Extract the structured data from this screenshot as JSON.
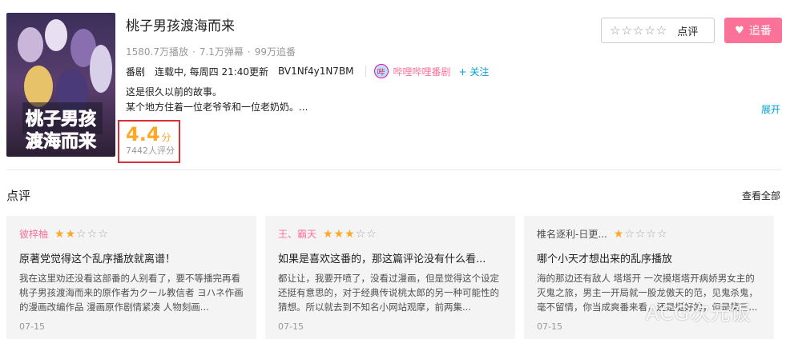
{
  "colors": {
    "accent": "#fb7299",
    "link": "#00a1d6",
    "score": "#ffa726",
    "highlight_border": "#d9313a"
  },
  "cover": {
    "title_overlay_top": "桃子男孩",
    "title_overlay_bottom": "渡海而来",
    "icon": "anime-cover-image"
  },
  "title": "桃子男孩渡海而来",
  "stats": {
    "plays": "1580.7万播放",
    "danmaku": "7.1万弹幕",
    "follows": "99万追番",
    "separator": "·"
  },
  "meta": {
    "type": "番剧",
    "status": "连载中, 每周四 21:40更新",
    "bvid": "BV1Nf4y1N7BM",
    "uploader": "哔哩哔哩番剧",
    "follow": "+ 关注"
  },
  "description": [
    "这是很久以前的故事。",
    "某个地方住着一位老爷爷和一位老奶奶。..."
  ],
  "expand": "展开",
  "score": {
    "value": "4.4",
    "unit": "分",
    "count": "7442人评分"
  },
  "rate_button": {
    "stars": "☆☆☆☆☆",
    "label": "点评"
  },
  "follow_button": {
    "label": "追番",
    "icon": "heart-icon"
  },
  "reviews_section": {
    "title": "点评",
    "see_all": "查看全部"
  },
  "reviews": [
    {
      "user": "彼梓柚",
      "rating": 2,
      "title": "原著党觉得这个乱序播放就离谱！",
      "body": "我在这里劝还没看这部番的人别看了，要不等播完再看桃子男孩渡海而来的原作者为クール教信者 ヨハネ作画的漫画改编作品 漫画原作剧情紧凑 人物刻画...",
      "date": "07-15"
    },
    {
      "user": "王、霸天",
      "rating": 3,
      "title": "如果是喜欢这番的，那这篇评论没有什么看...",
      "body": "都让让，我要开喷了，没看过漫画，但是觉得这个设定还挺有意思的，对于经典传说桃太郎的另一种可能性的猜想。所以就去到不知名小网站观摩，前两集...",
      "date": "07-15"
    },
    {
      "user": "椎名逐利-日更...",
      "rating": 1,
      "title": "哪个小天才想出来的乱序播放",
      "body": "海的那边还有敌人 塔塔开 一次摸塔塔开病娇男女主的灭鬼之旅，男主一开局就一股龙傲天的范，见鬼杀鬼，毫不留情，你当成爽番来看，还是挺好的，但是笑三...",
      "date": "07-15"
    }
  ],
  "watermark": "ACG次元饭"
}
